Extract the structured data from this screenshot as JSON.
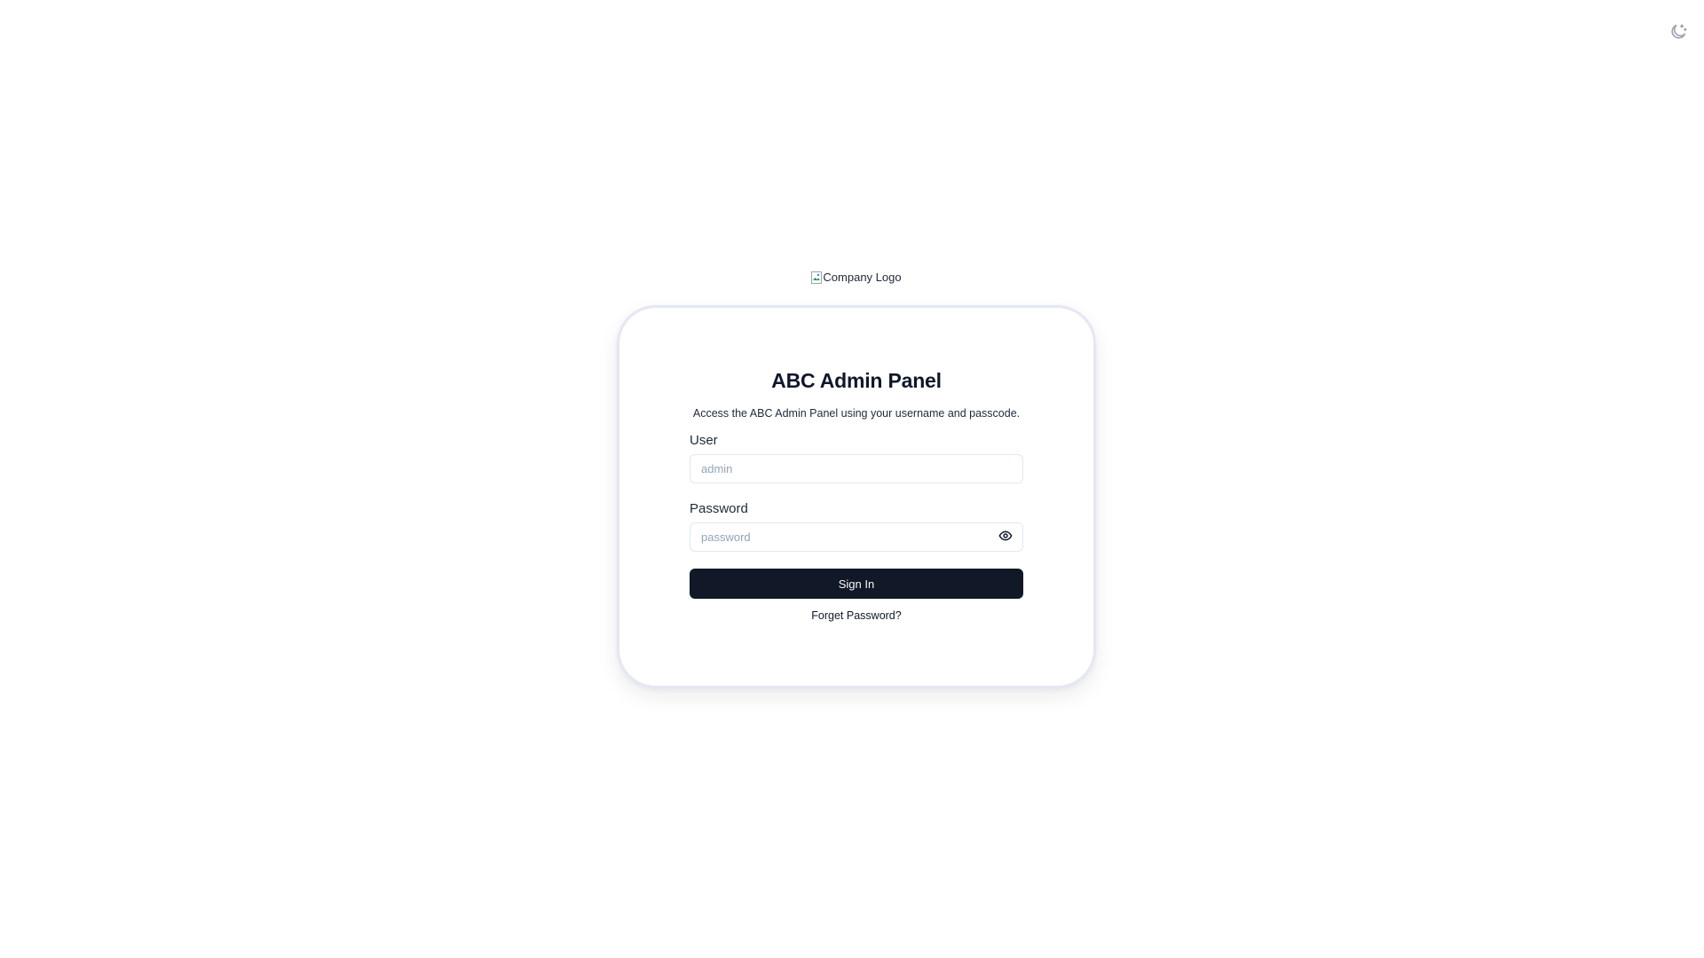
{
  "theme_toggle": {
    "icon": "moon-icon"
  },
  "logo": {
    "alt_text": "Company Logo",
    "icon": "broken-image-icon"
  },
  "login": {
    "title": "ABC Admin Panel",
    "subtitle": "Access the ABC Admin Panel using your username and passcode.",
    "user_label": "User",
    "user_value": "",
    "user_placeholder": "admin",
    "password_label": "Password",
    "password_value": "",
    "password_placeholder": "password",
    "show_password_icon": "eye-icon",
    "sign_in_label": "Sign In",
    "forgot_label": "Forget Password?"
  },
  "colors": {
    "primary_button": "#111827",
    "card_border": "#e5e7f3",
    "input_border": "#e2e8f0",
    "placeholder": "#94a3b8",
    "icon_gray": "#9ca3af"
  }
}
